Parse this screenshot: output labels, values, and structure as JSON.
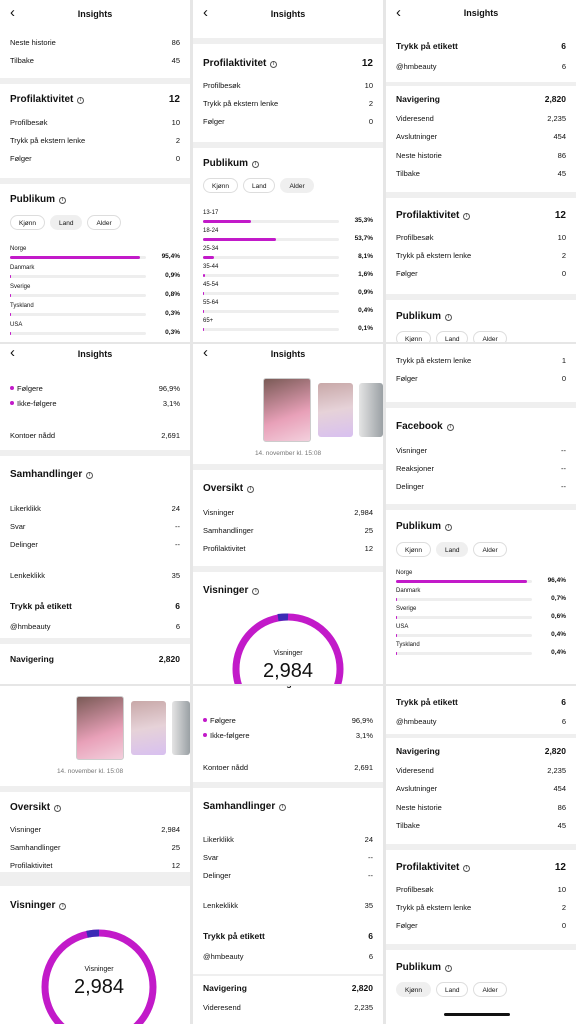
{
  "title": "Insights",
  "back": "‹",
  "neste_historie": "Neste historie",
  "tilbake": "Tilbake",
  "neste_val": "86",
  "tilbake_val": "45",
  "profil_title": "Profilaktivitet",
  "profil_total": "12",
  "profilbesok": "Profilbesøk",
  "profilbesok_val": "10",
  "ekstern": "Trykk på ekstern lenke",
  "ekstern_val": "2",
  "ekstern_val2": "1",
  "folger": "Følger",
  "folger_val": "0",
  "publikum_title": "Publikum",
  "chips": {
    "kjonn": "Kjønn",
    "land": "Land",
    "alder": "Alder"
  },
  "land1": [
    {
      "n": "Norge",
      "v": "95,4%"
    },
    {
      "n": "Danmark",
      "v": "0,9%"
    },
    {
      "n": "Sverige",
      "v": "0,8%"
    },
    {
      "n": "Tyskland",
      "v": "0,3%"
    },
    {
      "n": "USA",
      "v": "0,3%"
    }
  ],
  "alder": [
    {
      "n": "13-17",
      "v": "35,3%"
    },
    {
      "n": "18-24",
      "v": "53,7%"
    },
    {
      "n": "25-34",
      "v": "8,1%"
    },
    {
      "n": "35-44",
      "v": "1,6%"
    },
    {
      "n": "45-54",
      "v": "0,9%"
    },
    {
      "n": "55-64",
      "v": "0,4%"
    },
    {
      "n": "65+",
      "v": "0,1%"
    }
  ],
  "land2": [
    {
      "n": "Norge",
      "v": "96,4%"
    },
    {
      "n": "Danmark",
      "v": "0,7%"
    },
    {
      "n": "Sverige",
      "v": "0,6%"
    },
    {
      "n": "USA",
      "v": "0,4%"
    },
    {
      "n": "Tyskland",
      "v": "0,4%"
    }
  ],
  "trykk_etikett": "Trykk på etikett",
  "trykk_val": "6",
  "hmbeauty": "@hmbeauty",
  "hm_val": "6",
  "navigering": "Navigering",
  "nav_val": "2,820",
  "videresend": "Videresend",
  "videresend_val": "2,235",
  "avslutninger": "Avslutninger",
  "avslutninger_val": "454",
  "folgere": "Følgere",
  "folgere_val": "96,9%",
  "ikke_folgere": "Ikke-følgere",
  "ikke_val": "3,1%",
  "kontoer": "Kontoer nådd",
  "kontoer_val": "2,691",
  "samhandlinger": "Samhandlinger",
  "likerklikk": "Likerklikk",
  "liker_val": "24",
  "svar": "Svar",
  "svar_val": "--",
  "delinger": "Delinger",
  "delinger_val": "--",
  "lenkeklikk": "Lenkeklikk",
  "lenke_val": "35",
  "date": "14. november kl. 15:08",
  "oversikt": "Oversikt",
  "visninger": "Visninger",
  "visninger_val": "2,984",
  "samh_val": "25",
  "profilakt_label": "Profilaktivitet",
  "profilakt_val": "12",
  "visninger_title": "Visninger",
  "facebook": "Facebook",
  "reaksjoner": "Reaksjoner",
  "dash": "--"
}
